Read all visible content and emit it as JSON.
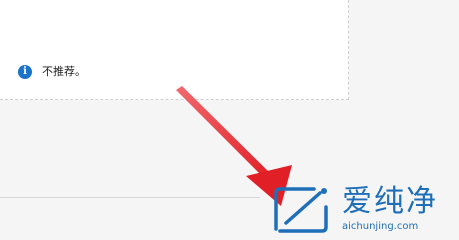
{
  "notice": {
    "icon": "info-icon",
    "icon_glyph": "i",
    "text": "不推荐。"
  },
  "watermark": {
    "title": "爱纯净",
    "domain": "aichunjing.com"
  },
  "colors": {
    "info_blue": "#1a73c9",
    "arrow_red": "#e8262c",
    "watermark_blue": "#1f6fb8"
  }
}
